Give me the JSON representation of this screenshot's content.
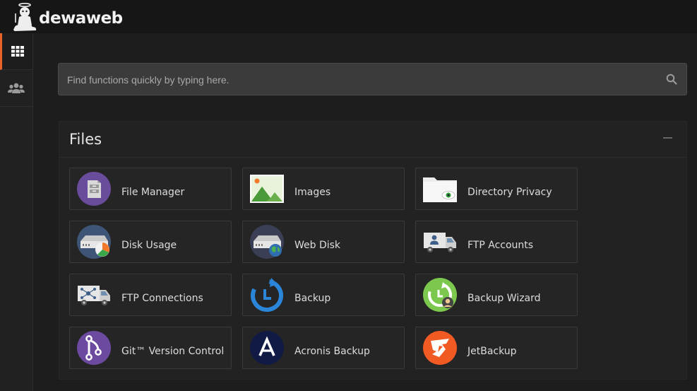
{
  "brand": {
    "name": "dewaweb"
  },
  "sidebar": {
    "items": [
      {
        "icon": "grid-icon",
        "active": true
      },
      {
        "icon": "users-icon",
        "active": false
      }
    ]
  },
  "search": {
    "placeholder": "Find functions quickly by typing here.",
    "value": ""
  },
  "files_panel": {
    "title": "Files",
    "items": [
      {
        "label": "File Manager",
        "icon": "file-manager-icon"
      },
      {
        "label": "Images",
        "icon": "images-icon"
      },
      {
        "label": "Directory Privacy",
        "icon": "directory-privacy-icon"
      },
      {
        "label": "Disk Usage",
        "icon": "disk-usage-icon"
      },
      {
        "label": "Web Disk",
        "icon": "web-disk-icon"
      },
      {
        "label": "FTP Accounts",
        "icon": "ftp-accounts-icon"
      },
      {
        "label": "FTP Connections",
        "icon": "ftp-connections-icon"
      },
      {
        "label": "Backup",
        "icon": "backup-icon"
      },
      {
        "label": "Backup Wizard",
        "icon": "backup-wizard-icon"
      },
      {
        "label": "Git™ Version Control",
        "icon": "git-icon"
      },
      {
        "label": "Acronis Backup",
        "icon": "acronis-icon"
      },
      {
        "label": "JetBackup",
        "icon": "jetbackup-icon"
      }
    ]
  },
  "colors": {
    "accent": "#e8622a",
    "background": "#1d1d1d",
    "panel": "#222222"
  }
}
